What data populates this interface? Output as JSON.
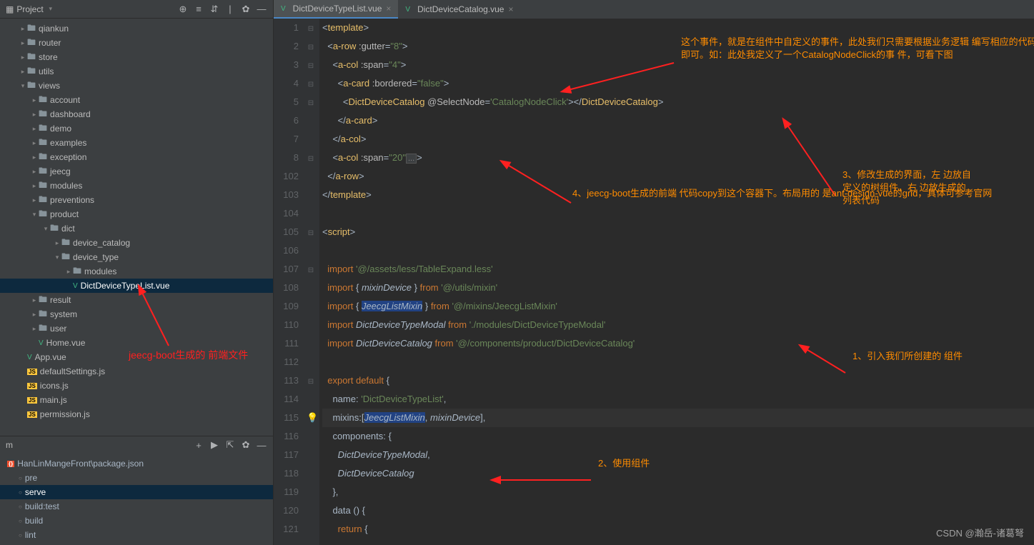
{
  "project": {
    "title": "Project",
    "tools": [
      "target-icon",
      "collapse-icon",
      "show-icon",
      "divider",
      "gear-icon",
      "hide-icon"
    ],
    "tree": [
      {
        "indent": 1,
        "chev": ">",
        "icon": "folder",
        "label": "qiankun"
      },
      {
        "indent": 1,
        "chev": ">",
        "icon": "folder",
        "label": "router"
      },
      {
        "indent": 1,
        "chev": ">",
        "icon": "folder",
        "label": "store"
      },
      {
        "indent": 1,
        "chev": ">",
        "icon": "folder",
        "label": "utils"
      },
      {
        "indent": 1,
        "chev": "v",
        "icon": "folder",
        "label": "views"
      },
      {
        "indent": 2,
        "chev": ">",
        "icon": "folder",
        "label": "account"
      },
      {
        "indent": 2,
        "chev": ">",
        "icon": "folder",
        "label": "dashboard"
      },
      {
        "indent": 2,
        "chev": ">",
        "icon": "folder",
        "label": "demo"
      },
      {
        "indent": 2,
        "chev": ">",
        "icon": "folder",
        "label": "examples"
      },
      {
        "indent": 2,
        "chev": ">",
        "icon": "folder",
        "label": "exception"
      },
      {
        "indent": 2,
        "chev": ">",
        "icon": "folder",
        "label": "jeecg"
      },
      {
        "indent": 2,
        "chev": ">",
        "icon": "folder",
        "label": "modules"
      },
      {
        "indent": 2,
        "chev": ">",
        "icon": "folder",
        "label": "preventions"
      },
      {
        "indent": 2,
        "chev": "v",
        "icon": "folder",
        "label": "product"
      },
      {
        "indent": 3,
        "chev": "v",
        "icon": "folder",
        "label": "dict"
      },
      {
        "indent": 4,
        "chev": ">",
        "icon": "folder",
        "label": "device_catalog"
      },
      {
        "indent": 4,
        "chev": "v",
        "icon": "folder",
        "label": "device_type"
      },
      {
        "indent": 5,
        "chev": ">",
        "icon": "folder",
        "label": "modules"
      },
      {
        "indent": 5,
        "chev": "",
        "icon": "vue",
        "label": "DictDeviceTypeList.vue",
        "selected": true
      },
      {
        "indent": 2,
        "chev": ">",
        "icon": "folder",
        "label": "result"
      },
      {
        "indent": 2,
        "chev": ">",
        "icon": "folder",
        "label": "system"
      },
      {
        "indent": 2,
        "chev": ">",
        "icon": "folder",
        "label": "user"
      },
      {
        "indent": 2,
        "chev": "",
        "icon": "vue",
        "label": "Home.vue"
      },
      {
        "indent": 1,
        "chev": "",
        "icon": "vue",
        "label": "App.vue"
      },
      {
        "indent": 1,
        "chev": "",
        "icon": "js",
        "label": "defaultSettings.js"
      },
      {
        "indent": 1,
        "chev": "",
        "icon": "js",
        "label": "icons.js"
      },
      {
        "indent": 1,
        "chev": "",
        "icon": "js",
        "label": "main.js"
      },
      {
        "indent": 1,
        "chev": "",
        "icon": "js",
        "label": "permission.js"
      }
    ]
  },
  "npm": {
    "title": "m",
    "root": "HanLinMangeFront\\package.json",
    "items": [
      {
        "label": "pre"
      },
      {
        "label": "serve",
        "selected": true
      },
      {
        "label": "build:test"
      },
      {
        "label": "build"
      },
      {
        "label": "lint"
      }
    ]
  },
  "tabs": [
    {
      "icon": "vue",
      "label": "DictDeviceTypeList.vue",
      "active": true
    },
    {
      "icon": "vue",
      "label": "DictDeviceCatalog.vue",
      "active": false
    }
  ],
  "lineNumbers": [
    "1",
    "2",
    "3",
    "4",
    "5",
    "6",
    "7",
    "8",
    "102",
    "103",
    "104",
    "105",
    "106",
    "107",
    "108",
    "109",
    "110",
    "111",
    "112",
    "113",
    "114",
    "115",
    "116",
    "117",
    "118",
    "119",
    "120",
    "121"
  ],
  "annotations": {
    "a_top": "这个事件，就是在组件中自定义的事件，此处我们只需要根据业务逻辑\n编写相应的代码即可。如：此处我定义了一个CatalogNodeClick的事\n件，可看下图",
    "a3": "3、修改生成的界面，左\n边放自定义的树组件，右\n边放生成的列表代码",
    "a4": "4、jeecg-boot生成的前端\n代码copy到这个容器下。布局用的\n是ant-design-vue的grid，具体可参考官网",
    "a1": "1、引入我们所创建的\n组件",
    "a2": "2、使用组件",
    "red": "jeecg-boot生成的\n前端文件"
  },
  "watermark": "CSDN @瀚岳-诸葛弩"
}
